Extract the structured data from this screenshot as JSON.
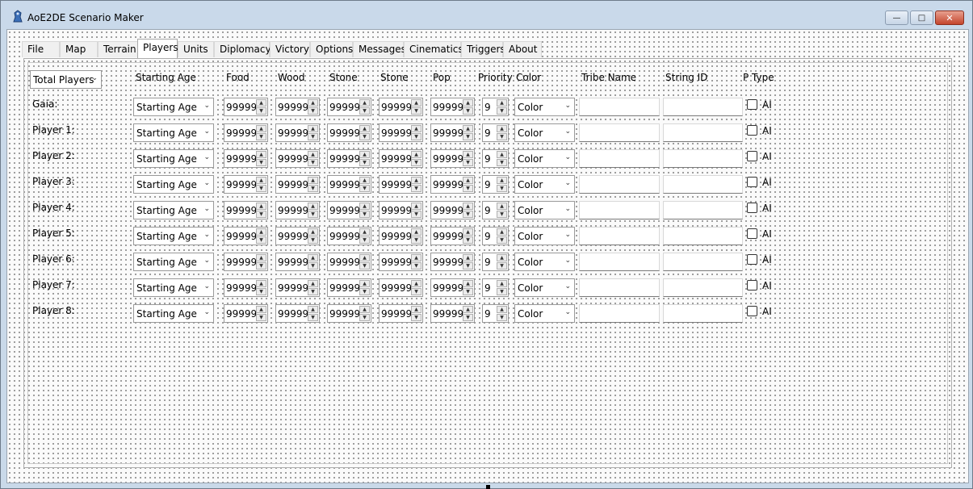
{
  "window": {
    "title": "AoE2DE Scenario Maker",
    "minimize_glyph": "—",
    "maximize_glyph": "□",
    "close_glyph": "✕"
  },
  "tabs": [
    {
      "label": "File"
    },
    {
      "label": "Map"
    },
    {
      "label": "Terrain"
    },
    {
      "label": "Players",
      "active": true
    },
    {
      "label": "Units"
    },
    {
      "label": "Diplomacy"
    },
    {
      "label": "Victory"
    },
    {
      "label": "Options"
    },
    {
      "label": "Messages"
    },
    {
      "label": "Cinematics"
    },
    {
      "label": "Triggers"
    },
    {
      "label": "About"
    }
  ],
  "players_tab": {
    "total_players_label": "Total Players",
    "headers": {
      "starting_age": "Starting Age",
      "food": "Food",
      "wood": "Wood",
      "stone": "Stone",
      "stone2": "Stone",
      "pop": "Pop",
      "priority": "Priority",
      "color": "Color",
      "tribe_name": "Tribe Name",
      "string_id": "String ID",
      "p_type": "P Type"
    },
    "rows": [
      {
        "label": "Gaia:",
        "age": "Starting Age",
        "food": "99999",
        "wood": "99999",
        "stone": "99999",
        "stone2": "99999",
        "pop": "99999",
        "priority": "9",
        "color": "Color",
        "ai": "AI"
      },
      {
        "label": "Player 1:",
        "age": "Starting Age",
        "food": "99999",
        "wood": "99999",
        "stone": "99999",
        "stone2": "99999",
        "pop": "99999",
        "priority": "9",
        "color": "Color",
        "ai": "AI"
      },
      {
        "label": "Player 2:",
        "age": "Starting Age",
        "food": "99999",
        "wood": "99999",
        "stone": "99999",
        "stone2": "99999",
        "pop": "99999",
        "priority": "9",
        "color": "Color",
        "ai": "AI"
      },
      {
        "label": "Player 3:",
        "age": "Starting Age",
        "food": "99999",
        "wood": "99999",
        "stone": "99999",
        "stone2": "99999",
        "pop": "99999",
        "priority": "9",
        "color": "Color",
        "ai": "AI"
      },
      {
        "label": "Player 4:",
        "age": "Starting Age",
        "food": "99999",
        "wood": "99999",
        "stone": "99999",
        "stone2": "99999",
        "pop": "99999",
        "priority": "9",
        "color": "Color",
        "ai": "AI"
      },
      {
        "label": "Player 5:",
        "age": "Starting Age",
        "food": "99999",
        "wood": "99999",
        "stone": "99999",
        "stone2": "99999",
        "pop": "99999",
        "priority": "9",
        "color": "Color",
        "ai": "AI"
      },
      {
        "label": "Player 6:",
        "age": "Starting Age",
        "food": "99999",
        "wood": "99999",
        "stone": "99999",
        "stone2": "99999",
        "pop": "99999",
        "priority": "9",
        "color": "Color",
        "ai": "AI"
      },
      {
        "label": "Player 7:",
        "age": "Starting Age",
        "food": "99999",
        "wood": "99999",
        "stone": "99999",
        "stone2": "99999",
        "pop": "99999",
        "priority": "9",
        "color": "Color",
        "ai": "AI"
      },
      {
        "label": "Player 8:",
        "age": "Starting Age",
        "food": "99999",
        "wood": "99999",
        "stone": "99999",
        "stone2": "99999",
        "pop": "99999",
        "priority": "9",
        "color": "Color",
        "ai": "AI"
      }
    ]
  }
}
